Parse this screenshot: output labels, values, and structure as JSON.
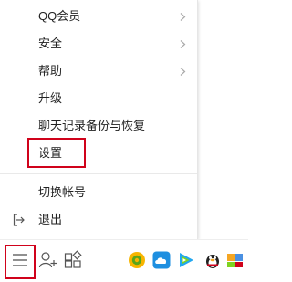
{
  "menu": {
    "items": [
      {
        "label": "QQ会员"
      },
      {
        "label": "安全"
      },
      {
        "label": "帮助"
      },
      {
        "label": "升级"
      },
      {
        "label": "聊天记录备份与恢复"
      },
      {
        "label": "设置"
      },
      {
        "label": "切换帐号"
      },
      {
        "label": "退出"
      }
    ],
    "submenu_icon": "chevron-right-icon",
    "highlighted_item": "设置"
  },
  "bottom_toolbar": {
    "buttons": [
      {
        "icon": "hamburger-menu-icon"
      },
      {
        "icon": "add-friend-icon"
      },
      {
        "icon": "app-manager-icon"
      },
      {
        "icon": "qq-game-icon"
      },
      {
        "icon": "weiyun-icon"
      },
      {
        "icon": "tencent-video-icon"
      },
      {
        "icon": "qq-pet-icon"
      },
      {
        "icon": "more-apps-icon"
      }
    ]
  },
  "colors": {
    "highlight_border": "#d0021b",
    "menu_text": "#222222",
    "chevron": "#aaaaaa",
    "separator": "#e9e9e9"
  }
}
